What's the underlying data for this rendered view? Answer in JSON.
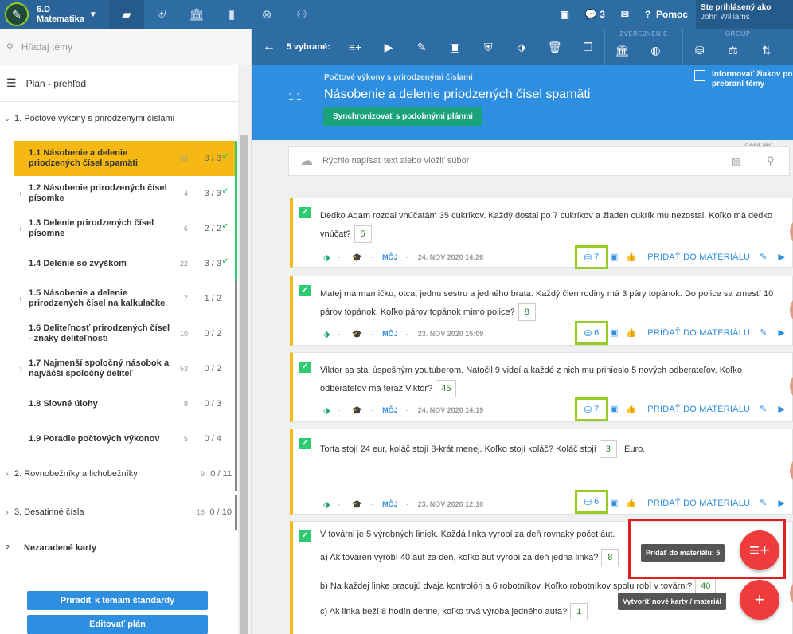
{
  "topbar": {
    "class_line1": "6.D",
    "class_line2": "Matematika",
    "cast_count": "",
    "chat_count": "3",
    "help": "Pomoc",
    "logged_label": "Ste prihlásený ako",
    "user_name": "John Williams"
  },
  "sidebar": {
    "search_placeholder": "Hľadaj témy",
    "plan_overview": "Plán - prehľad",
    "sections": [
      {
        "title": "1. Počtové výkony s prirodzenými číslami"
      },
      {
        "title": "2. Rovnobežníky a lichobežníky",
        "count": "9",
        "progress": "0 / 11"
      },
      {
        "title": "3. Desatinné čísla",
        "count": "16",
        "progress": "0 / 10"
      }
    ],
    "topics": [
      {
        "title": "1.1  Násobenie a delenie priodzených čísel spamäti",
        "count": "53",
        "progress": "3 / 3"
      },
      {
        "title": "1.2  Násobenie prirodzených čísel písomke",
        "count": "4",
        "progress": "3 / 3"
      },
      {
        "title": "1.3  Delenie prirodzených čísel písomne",
        "count": "6",
        "progress": "2 / 2"
      },
      {
        "title": "1.4  Delenie so zvyškom",
        "count": "22",
        "progress": "3 / 3"
      },
      {
        "title": "1.5  Násobenie a delenie prirodzených čísel na kalkulačke",
        "count": "7",
        "progress": "1 / 2"
      },
      {
        "title": "1.6  Deliteľnosť prirodzených čísel - znaky deliteľnosti",
        "count": "10",
        "progress": "0 / 2"
      },
      {
        "title": "1.7  Najmenší spoločný násobok a najväčší spoločný deliteľ",
        "count": "53",
        "progress": "0 / 2"
      },
      {
        "title": "1.8  Slovné úlohy",
        "count": "8",
        "progress": "0 / 3"
      },
      {
        "title": "1.9  Poradie počtových výkonov",
        "count": "5",
        "progress": "0 / 4"
      }
    ],
    "unassigned": "Nezaradené karty",
    "btn_standards": "Priradiť k témam štandardy",
    "btn_edit": "Editovať plán"
  },
  "toolbar": {
    "selected": "5 vybrané:",
    "group_public": "ZVEREJNENIE",
    "group_group": "GROUP"
  },
  "header": {
    "subtitle": "Počtové výkony s prirodzenými číslami",
    "number": "1.1",
    "title": "Násobenie a delenie priodzených čísel spamäti",
    "sync_btn": "Synchronizovať s podobnými plánmi",
    "inform": "Informovať žiakov po prebraní témy"
  },
  "quick_input": {
    "placeholder": "Rýchlo napísať text alebo vložiť súbor",
    "hint": "Zvyšiť text"
  },
  "cards": [
    {
      "text": "Dedko Adam rozdal vnúčatám 35 cukríkov. Každý dostal po 7 cukríkov a žiaden cukrík mu nezostal. Koľko má dedko vnúčat?",
      "answer": "5",
      "owner": "MÔJ",
      "date": "24. NOV 2020 14:26",
      "db": "7",
      "add": "PRIDAŤ DO MATERIÁLU"
    },
    {
      "text": "Matej má mamičku, otca, jednu sestru a jedného brata. Každý člen rodiny má 3 páry topánok. Do police sa zmestí 10 párov topánok. Koľko párov topánok mimo police?",
      "answer": "8",
      "owner": "MÔJ",
      "date": "23. NOV 2020 15:09",
      "db": "6",
      "add": "PRIDAŤ DO MATERIÁLU"
    },
    {
      "text": "Viktor sa stal úspešným youtuberom. Natočil 9 videí a každé z nich mu prinieslo 5 nových odberateľov. Koľko odberateľov má teraz Viktor?",
      "answer": "45",
      "owner": "MÔJ",
      "date": "24. NOV 2020 14:19",
      "db": "7",
      "add": "PRIDAŤ DO MATERIÁLU"
    },
    {
      "text": "Torta stojí 24 eur, koláč stojí 8-krát menej. Koľko stojí koláč? Koláč stojí",
      "answer": "3",
      "suffix": "Euro.",
      "owner": "MÔJ",
      "date": "23. NOV 2020 12:10",
      "db": "6",
      "add": "PRIDAŤ DO MATERIÁLU"
    }
  ],
  "card5": {
    "intro": "V továrni je 5 výrobných liniek. Každá linka vyrobí za deň rovnaký počet áut.",
    "qa": "a) Ak továreň vyrobí 40 áut za deň, koľko áut vyrobí za deň jedna linka?",
    "qa_ans": "8",
    "qb": "b) Na každej linke pracujú dvaja kontrolóri a 6 robotníkov. Koľko robotníkov spolu robí v továrni?",
    "qb_ans": "40",
    "qc": "c) Ak linka beží 8 hodín denne, koľko trvá výroba jedného auta?",
    "qc_ans": "1"
  },
  "fab": {
    "add_tooltip": "Pridať do materiálu: 5",
    "create_tooltip": "Vytvoriť nové karty / materiál"
  },
  "colors": {
    "accent": "#2e6da4",
    "header": "#2e8ee0",
    "active_topic": "#f6b813",
    "highlight": "#99cc22",
    "fab": "#ef3b3b"
  }
}
